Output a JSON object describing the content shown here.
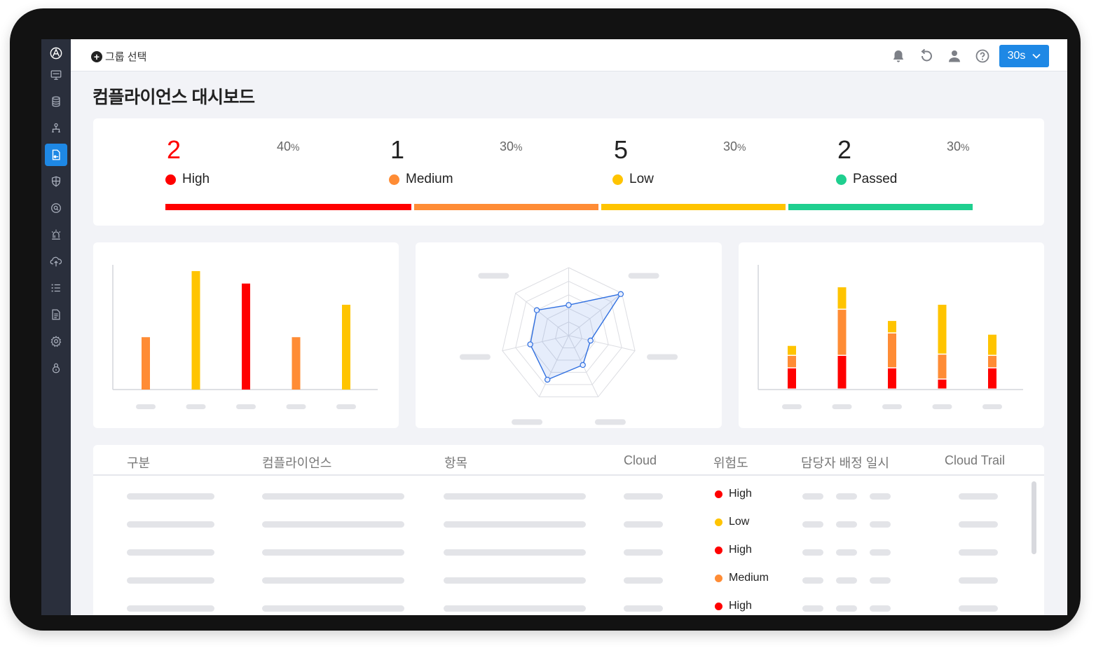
{
  "header": {
    "group_select_label": "그룹 선택",
    "refresh_interval": "30s"
  },
  "page_title": "컴플라이언스 대시보드",
  "summary": {
    "items": [
      {
        "count": "2",
        "percent": "40",
        "percent_unit": "%",
        "label": "High",
        "color": "#ff0000",
        "count_color": "#ff0000"
      },
      {
        "count": "1",
        "percent": "30",
        "percent_unit": "%",
        "label": "Medium",
        "color": "#ff8c35",
        "count_color": "#222222"
      },
      {
        "count": "5",
        "percent": "30",
        "percent_unit": "%",
        "label": "Low",
        "color": "#ffc400",
        "count_color": "#222222"
      },
      {
        "count": "2",
        "percent": "30",
        "percent_unit": "%",
        "label": "Passed",
        "color": "#1fcf8f",
        "count_color": "#222222"
      }
    ]
  },
  "colors": {
    "high": "#ff0000",
    "medium": "#ff8c35",
    "low": "#ffc400",
    "passed": "#1fcf8f",
    "accent": "#1e88e5",
    "radar": "#2f6fe0"
  },
  "chart_data": [
    {
      "type": "bar",
      "categories": [
        "",
        "",
        "",
        "",
        ""
      ],
      "values": [
        42,
        95,
        85,
        42,
        68
      ],
      "bar_colors": [
        "medium",
        "low",
        "high",
        "medium",
        "low"
      ],
      "ylim": [
        0,
        100
      ],
      "grid": false
    },
    {
      "type": "radar",
      "axes": [
        "",
        "",
        "",
        "",
        "",
        "",
        ""
      ],
      "values": [
        0.45,
        0.98,
        0.33,
        0.48,
        0.72,
        0.58,
        0.6
      ],
      "rlim": [
        0,
        1
      ],
      "rings": 5
    },
    {
      "type": "bar",
      "stacked": true,
      "categories": [
        "",
        "",
        "",
        "",
        ""
      ],
      "series": [
        {
          "color": "high",
          "values": [
            17,
            27,
            17,
            8,
            17
          ]
        },
        {
          "color": "medium",
          "values": [
            10,
            37,
            28,
            20,
            10
          ]
        },
        {
          "color": "low",
          "values": [
            8,
            18,
            10,
            40,
            17
          ]
        }
      ],
      "ylim": [
        0,
        100
      ],
      "grid": false
    }
  ],
  "table": {
    "columns": [
      "구분",
      "컴플라이언스",
      "항목",
      "Cloud",
      "위험도",
      "담당자 배정 일시",
      "Cloud Trail"
    ],
    "rows": [
      {
        "risk": "High",
        "risk_color": "#ff0000"
      },
      {
        "risk": "Low",
        "risk_color": "#ffc400"
      },
      {
        "risk": "High",
        "risk_color": "#ff0000"
      },
      {
        "risk": "Medium",
        "risk_color": "#ff8c35"
      },
      {
        "risk": "High",
        "risk_color": "#ff0000"
      }
    ]
  },
  "sidebar": {
    "icons": [
      "logo-icon",
      "monitor-icon",
      "database-icon",
      "network-icon",
      "compliance-icon",
      "shield-icon",
      "scan-icon",
      "alarm-icon",
      "cloud-upload-icon",
      "list-icon",
      "document-icon",
      "settings-icon",
      "lock-icon"
    ],
    "active_index": 4
  }
}
